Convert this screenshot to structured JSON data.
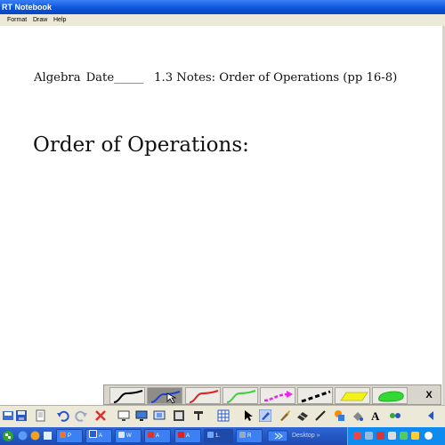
{
  "window": {
    "title": "RT Notebook"
  },
  "menu": {
    "items": [
      "Format",
      "Draw",
      "Help"
    ]
  },
  "document": {
    "notes_line": {
      "subject": "Algebra",
      "date_label": "Date_____",
      "lesson": "1.3 Notes: Order of Operations (pp 16-8)"
    },
    "heading": "Order of Operations:"
  },
  "pen_tray": {
    "pens": [
      {
        "name": "black-pen",
        "color": "#000000"
      },
      {
        "name": "blue-pen",
        "color": "#1f3fd6"
      },
      {
        "name": "red-pen",
        "color": "#e32020"
      },
      {
        "name": "green-pen",
        "color": "#3ed13e"
      },
      {
        "name": "magenta-arrow-pen",
        "color": "#ee22ee"
      },
      {
        "name": "dashed-pen",
        "color": "#000000"
      },
      {
        "name": "yellow-highlighter",
        "color": "#f2f21a"
      },
      {
        "name": "green-highlighter",
        "color": "#32d932"
      }
    ],
    "selected_index": 1,
    "close_label": "X"
  },
  "toolbar": {
    "icons": [
      "disk-icon",
      "save-icon",
      "undo-icon",
      "redo-icon",
      "delete-icon",
      "screen-shade-icon",
      "display-icon",
      "capture-icon",
      "insert-icon",
      "table-icon",
      "select-icon",
      "pen-icon",
      "creative-pen-icon",
      "eraser-icon",
      "line-icon",
      "shape-icon",
      "fill-icon",
      "text-icon",
      "properties-icon"
    ]
  },
  "taskbar": {
    "tasks": [
      {
        "label": "P",
        "icon": "firefox-icon",
        "icon_color": "#e8772a"
      },
      {
        "label": "A",
        "icon": "word-icon",
        "icon_color": "#2c5fc9"
      },
      {
        "label": "W",
        "icon": "window-icon",
        "icon_color": "#dfe6f5"
      },
      {
        "label": "A",
        "icon": "app-icon",
        "icon_color": "#d33"
      },
      {
        "label": "A",
        "icon": "pdf-icon",
        "icon_color": "#d22"
      },
      {
        "label": "1.",
        "icon": "notebook-icon",
        "icon_color": "#6aa8ff"
      },
      {
        "label": "R",
        "icon": "app-icon",
        "icon_color": "#9ab"
      }
    ],
    "desktop_label": "Desktop"
  }
}
